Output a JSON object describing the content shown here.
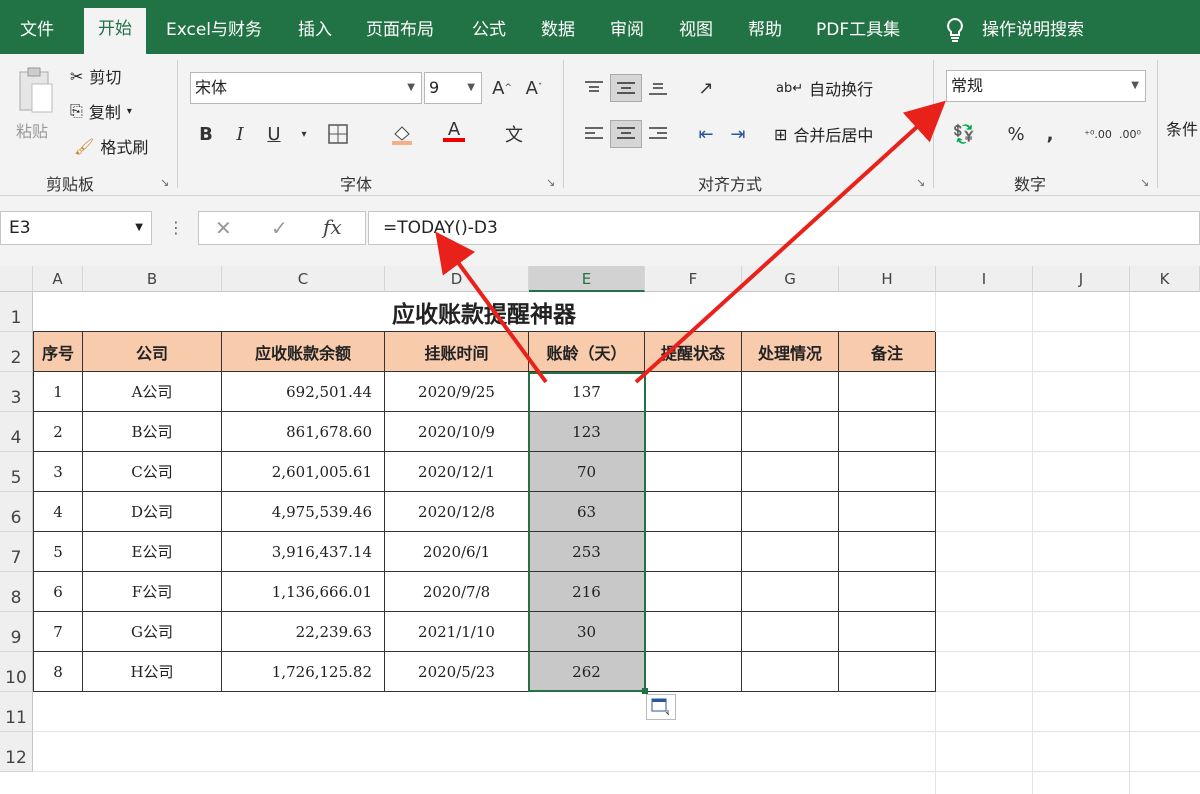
{
  "menu": {
    "tabs": [
      "文件",
      "开始",
      "Excel与财务",
      "插入",
      "页面布局",
      "公式",
      "数据",
      "审阅",
      "视图",
      "帮助",
      "PDF工具集"
    ],
    "active_tab": "开始",
    "search_label": "操作说明搜索"
  },
  "ribbon": {
    "clipboard": {
      "paste": "粘贴",
      "cut": "剪切",
      "copy": "复制",
      "format_painter": "格式刷",
      "label": "剪贴板"
    },
    "font": {
      "font_name": "宋体",
      "font_size": "9",
      "bold": "B",
      "italic": "I",
      "underline": "U",
      "label": "字体"
    },
    "alignment": {
      "wrap_text": "自动换行",
      "merge_center": "合并后居中",
      "label": "对齐方式"
    },
    "number": {
      "format": "常规",
      "percent": "%",
      "comma": ",",
      "label": "数字"
    },
    "styles": {
      "conditional": "条件"
    }
  },
  "formula_bar": {
    "name_box": "E3",
    "formula": "=TODAY()-D3",
    "fx": "fx"
  },
  "sheet": {
    "columns": [
      "A",
      "B",
      "C",
      "D",
      "E",
      "F",
      "G",
      "H",
      "I",
      "J",
      "K"
    ],
    "rows": [
      "1",
      "2",
      "3",
      "4",
      "5",
      "6",
      "7",
      "8",
      "9",
      "10",
      "11",
      "12"
    ],
    "title": "应收账款提醒神器",
    "headers": [
      "序号",
      "公司",
      "应收账款余额",
      "挂账时间",
      "账龄（天）",
      "提醒状态",
      "处理情况",
      "备注"
    ],
    "data": [
      [
        "1",
        "A公司",
        "692,501.44",
        "2020/9/25",
        "137"
      ],
      [
        "2",
        "B公司",
        "861,678.60",
        "2020/10/9",
        "123"
      ],
      [
        "3",
        "C公司",
        "2,601,005.61",
        "2020/12/1",
        "70"
      ],
      [
        "4",
        "D公司",
        "4,975,539.46",
        "2020/12/8",
        "63"
      ],
      [
        "5",
        "E公司",
        "3,916,437.14",
        "2020/6/1",
        "253"
      ],
      [
        "6",
        "F公司",
        "1,136,666.01",
        "2020/7/8",
        "216"
      ],
      [
        "7",
        "G公司",
        "22,239.63",
        "2021/1/10",
        "30"
      ],
      [
        "8",
        "H公司",
        "1,726,125.82",
        "2020/5/23",
        "262"
      ]
    ]
  },
  "colors": {
    "accent": "#217346",
    "header_fill": "#f8cbad",
    "selection": "#c8c8c8",
    "arrow": "#e8221b"
  }
}
